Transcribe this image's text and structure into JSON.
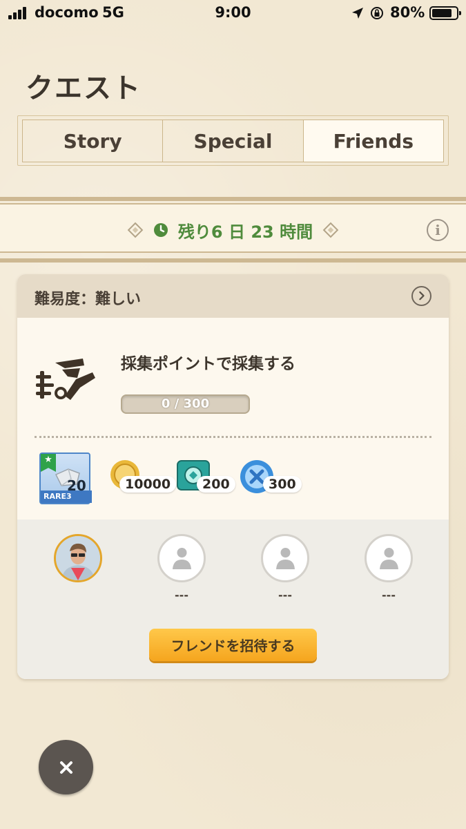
{
  "status_bar": {
    "carrier": "docomo",
    "network": "5G",
    "time": "9:00",
    "battery": "80%"
  },
  "page": {
    "title": "クエスト"
  },
  "tabs": [
    {
      "label": "Story",
      "active": false
    },
    {
      "label": "Special",
      "active": false
    },
    {
      "label": "Friends",
      "active": true
    }
  ],
  "timer": {
    "remaining": "残り6 日 23 時間"
  },
  "quest": {
    "difficulty": "難易度：難しい",
    "title": "採集ポイントで採集する",
    "progress_text": "0 / 300",
    "progress_fraction": 0,
    "rewards": [
      {
        "name": "material",
        "rarity": "RARE3",
        "count": "20"
      },
      {
        "name": "coin",
        "count": "10000"
      },
      {
        "name": "gem",
        "count": "200"
      },
      {
        "name": "orb",
        "count": "300"
      }
    ]
  },
  "friends": {
    "slots": [
      {
        "filled": true,
        "label": ""
      },
      {
        "filled": false,
        "label": "---"
      },
      {
        "filled": false,
        "label": "---"
      },
      {
        "filled": false,
        "label": "---"
      }
    ],
    "invite_label": "フレンドを招待する"
  },
  "colors": {
    "accent_green": "#4f8b3c",
    "invite_orange": "#f5a51e",
    "self_ring": "#e4a62b"
  },
  "icons": {
    "timer": "clock-icon",
    "info": "info-icon",
    "header": "chevron-right-icon",
    "close": "close-icon",
    "quest": "gathering-icon"
  }
}
